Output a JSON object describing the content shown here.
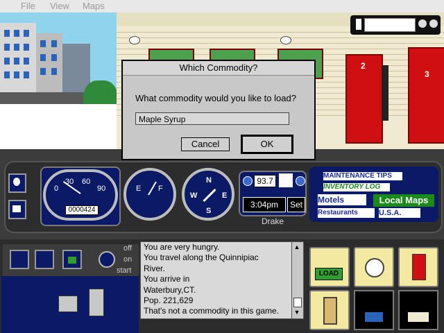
{
  "menubar": {
    "items": [
      {
        "label": "File"
      },
      {
        "label": "View"
      },
      {
        "label": "Maps"
      }
    ]
  },
  "motel": {
    "door2": "2",
    "door3": "3"
  },
  "dashboard": {
    "speedometer": {
      "ticks": [
        "0",
        "30",
        "60",
        "90"
      ],
      "odometer": "0000424"
    },
    "fuel": {
      "empty": "E",
      "full": "F"
    },
    "compass": {
      "n": "N",
      "s": "S",
      "e": "E",
      "w": "W"
    },
    "radio": {
      "frequency": "93.7"
    },
    "clock": {
      "time": "3:04pm",
      "set_label": "Set"
    },
    "driver": "Drake",
    "books": {
      "maintenance": "MAINTENANCE TIPS",
      "inventory": "INVENTORY LOG",
      "motels": "Motels",
      "restaurants": "Restaurants",
      "local_maps": "Local Maps",
      "usa": "U.S.A."
    }
  },
  "controls": {
    "off": "off",
    "on": "on",
    "start": "start"
  },
  "messages": [
    "You are very hungry.",
    "You travel along the Quinnipiac",
    "River.",
    "You arrive in",
    "Waterbury,CT.",
    "Pop. 221,629",
    "That's not a commodity in this game."
  ],
  "actions": {
    "load": "LOAD"
  },
  "dialog": {
    "title": "Which Commodity?",
    "question": "What commodity would you like to load?",
    "value": "Maple Syrup",
    "cancel": "Cancel",
    "ok": "OK"
  },
  "colors": {
    "dash_panel": "#0b1a66",
    "door": "#d01010",
    "load_green": "#2e9e2e"
  }
}
